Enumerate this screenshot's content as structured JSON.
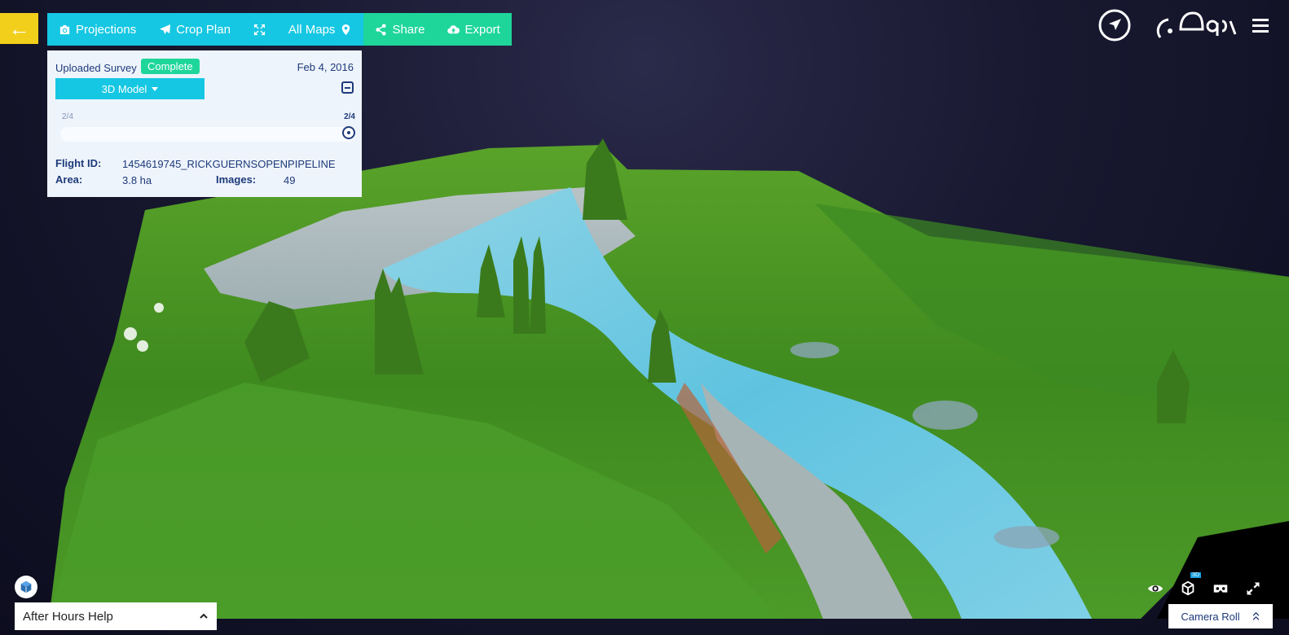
{
  "toolbar": {
    "back_icon": "arrow-left-icon",
    "items": [
      {
        "label": "Projections",
        "icon": "camera-icon"
      },
      {
        "label": "Crop Plan",
        "icon": "plane-icon"
      },
      {
        "label": "",
        "icon": "fullscreen-icon"
      },
      {
        "label": "All Maps",
        "icon": "map-pin-icon"
      },
      {
        "label": "Share",
        "icon": "share-icon"
      },
      {
        "label": "Export",
        "icon": "cloud-upload-icon"
      }
    ]
  },
  "survey": {
    "title": "Uploaded Survey",
    "status": "Complete",
    "date": "Feb 4, 2016",
    "view_mode": "3D Model",
    "slider": {
      "min_label": "2/4",
      "max_label": "2/4",
      "value_fraction": 1.0
    },
    "flight_id_label": "Flight ID:",
    "flight_id": "1454619745_RICKGUERNSOPENPIPELINE",
    "area_label": "Area:",
    "area": "3.8 ha",
    "images_label": "Images:",
    "images": "49"
  },
  "top_right": {
    "navigate_icon": "compass-navigation-icon",
    "logo_icon": "dronedeploy-logo-icon",
    "menu_icon": "hamburger-menu-icon"
  },
  "footer": {
    "help_label": "After Hours Help",
    "camera_roll_label": "Camera Roll",
    "view_controls": [
      "eye-icon",
      "3d-cube-icon",
      "vr-headset-icon",
      "expand-icon"
    ],
    "cube_badge": "3D"
  },
  "colors": {
    "yellow": "#f2cf1a",
    "cyan": "#15c7e2",
    "green": "#1ed69a",
    "navy": "#1d3a7a"
  }
}
